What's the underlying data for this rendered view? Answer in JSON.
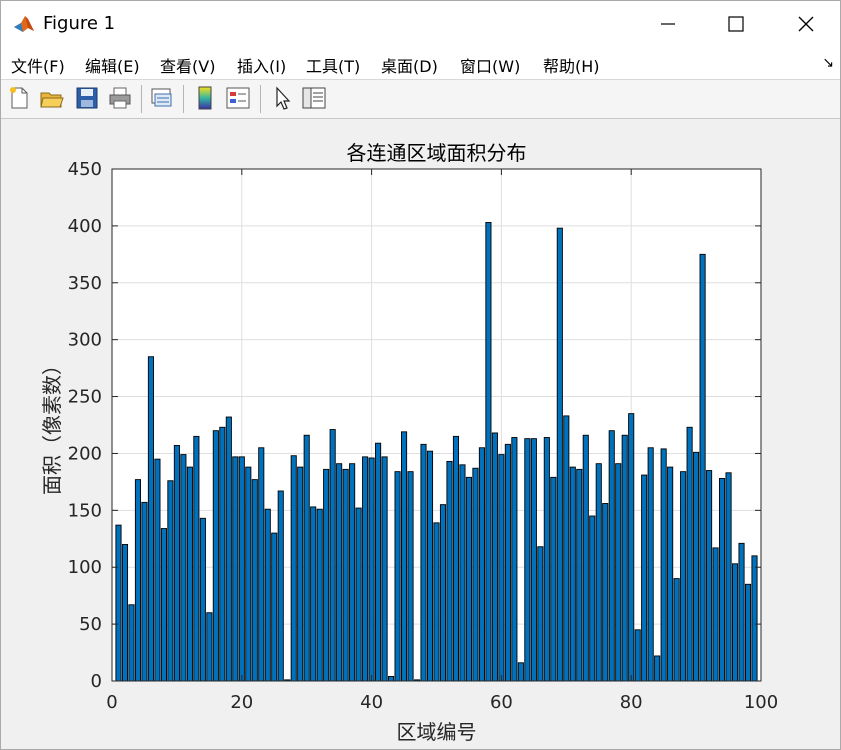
{
  "window": {
    "title": "Figure 1"
  },
  "menu": [
    "文件(F)",
    "编辑(E)",
    "查看(V)",
    "插入(I)",
    "工具(T)",
    "桌面(D)",
    "窗口(W)",
    "帮助(H)"
  ],
  "toolbar_icons": [
    "new-figure-icon",
    "open-file-icon",
    "save-icon",
    "print-icon",
    "link-plot-icon",
    "colorbar-icon",
    "legend-icon",
    "pointer-icon",
    "property-inspector-icon"
  ],
  "colors": {
    "bar_fill": "#0072BD",
    "bar_edge": "#000000",
    "grid": "#dfdfdf",
    "axes_bg": "#ffffff",
    "figure_bg": "#f0f0f0"
  },
  "chart_data": {
    "type": "bar",
    "title": "各连通区域面积分布",
    "xlabel": "区域编号",
    "ylabel": "面积（像素数）",
    "xlim": [
      0,
      100
    ],
    "ylim": [
      0,
      450
    ],
    "xticks": [
      0,
      20,
      40,
      60,
      80,
      100
    ],
    "yticks": [
      0,
      50,
      100,
      150,
      200,
      250,
      300,
      350,
      400,
      450
    ],
    "grid": true,
    "x": [
      1,
      2,
      3,
      4,
      5,
      6,
      7,
      8,
      9,
      10,
      11,
      12,
      13,
      14,
      15,
      16,
      17,
      18,
      19,
      20,
      21,
      22,
      23,
      24,
      25,
      26,
      27,
      28,
      29,
      30,
      31,
      32,
      33,
      34,
      35,
      36,
      37,
      38,
      39,
      40,
      41,
      42,
      43,
      44,
      45,
      46,
      47,
      48,
      49,
      50,
      51,
      52,
      53,
      54,
      55,
      56,
      57,
      58,
      59,
      60,
      61,
      62,
      63,
      64,
      65,
      66,
      67,
      68,
      69,
      70,
      71,
      72,
      73,
      74,
      75,
      76,
      77,
      78,
      79,
      80,
      81,
      82,
      83,
      84,
      85,
      86,
      87,
      88,
      89,
      90,
      91,
      92,
      93,
      94,
      95,
      96,
      97,
      98,
      99
    ],
    "values": [
      137,
      120,
      67,
      177,
      157,
      285,
      195,
      134,
      176,
      207,
      199,
      188,
      215,
      143,
      60,
      220,
      223,
      232,
      197,
      197,
      188,
      177,
      205,
      151,
      130,
      167,
      1,
      198,
      188,
      216,
      153,
      151,
      186,
      221,
      191,
      186,
      191,
      152,
      197,
      196,
      209,
      197,
      4,
      184,
      219,
      184,
      1,
      208,
      202,
      139,
      155,
      193,
      215,
      190,
      179,
      187,
      205,
      403,
      218,
      199,
      208,
      214,
      16,
      213,
      213,
      118,
      214,
      179,
      398,
      233,
      188,
      186,
      216,
      145,
      191,
      156,
      220,
      191,
      216,
      235,
      45,
      181,
      205,
      22,
      204,
      188,
      90,
      184,
      223,
      201,
      375,
      185,
      117,
      178,
      183,
      103,
      121,
      85,
      110
    ]
  }
}
